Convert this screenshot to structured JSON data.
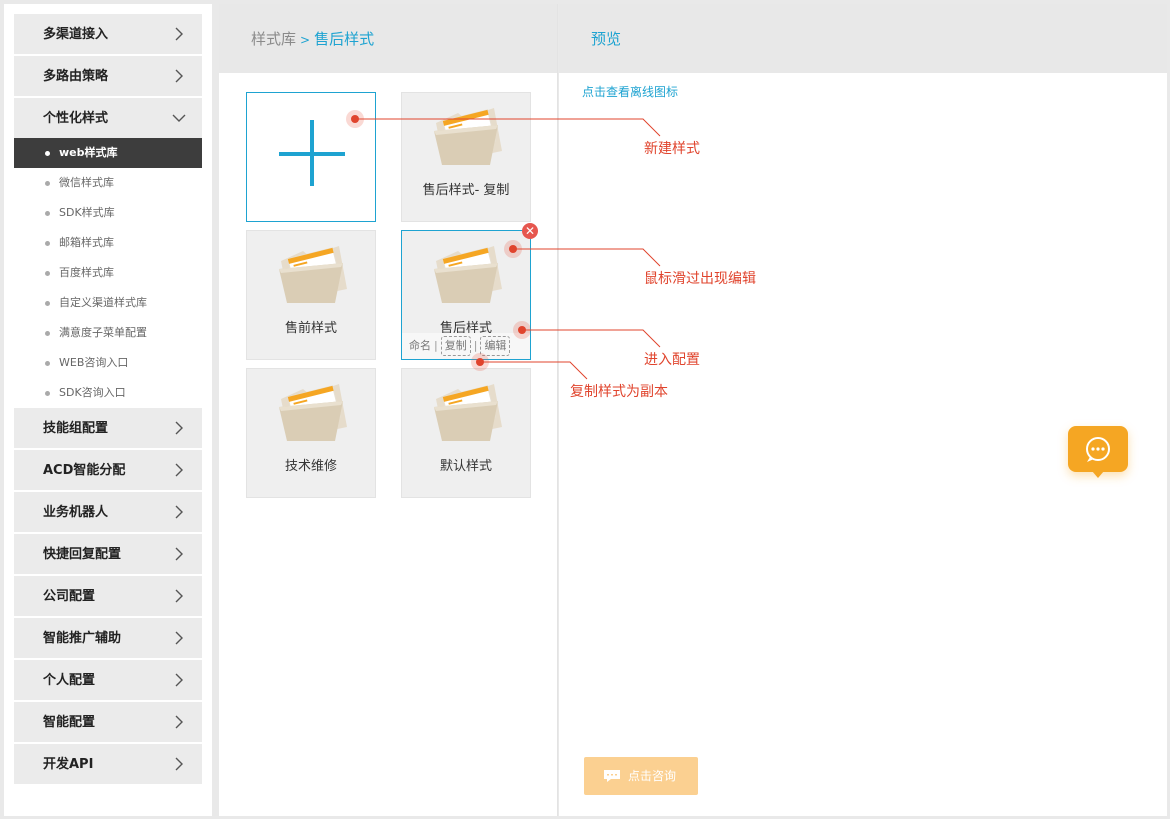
{
  "sidebar": {
    "items": [
      {
        "label": "多渠道接入"
      },
      {
        "label": "多路由策略"
      },
      {
        "label": "个性化样式",
        "open": true
      },
      {
        "label": "技能组配置"
      },
      {
        "label": "ACD智能分配"
      },
      {
        "label": "业务机器人"
      },
      {
        "label": "快捷回复配置"
      },
      {
        "label": "公司配置"
      },
      {
        "label": "智能推广辅助"
      },
      {
        "label": "个人配置"
      },
      {
        "label": "智能配置"
      },
      {
        "label": "开发API"
      }
    ],
    "sub_items": [
      {
        "label": "web样式库",
        "active": true
      },
      {
        "label": "微信样式库"
      },
      {
        "label": "SDK样式库"
      },
      {
        "label": "邮箱样式库"
      },
      {
        "label": "百度样式库"
      },
      {
        "label": "自定义渠道样式库"
      },
      {
        "label": "满意度子菜单配置"
      },
      {
        "label": "WEB咨询入口"
      },
      {
        "label": "SDK咨询入口"
      }
    ]
  },
  "breadcrumb": {
    "root": "样式库",
    "separator": ">",
    "current": "售后样式"
  },
  "cards": [
    {
      "label": "售后样式- 复制"
    },
    {
      "label": "售前样式"
    },
    {
      "label": "售后样式"
    },
    {
      "label": "技术维修"
    },
    {
      "label": "默认样式"
    }
  ],
  "card_actions": {
    "rename": "命名",
    "copy": "复制",
    "edit": "编辑",
    "separator": "|"
  },
  "preview": {
    "title": "预览",
    "offline_link": "点击查看离线图标",
    "consult_button": "点击咨询"
  },
  "annotations": {
    "new_style": "新建样式",
    "hover_edit": "鼠标滑过出现编辑",
    "enter_config": "进入配置",
    "copy_style": "复制样式为副本"
  },
  "colors": {
    "accent": "#1ea3d1",
    "annotation": "#e0442d",
    "chat_orange": "#f5a623",
    "sidebar_active": "#3d3d3d"
  },
  "icons": {
    "chevron_right": "chevron-right-icon",
    "chevron_down": "chevron-down-icon",
    "plus": "plus-icon",
    "folder": "folder-icon",
    "close": "close-icon",
    "chat": "chat-bubble-icon"
  }
}
